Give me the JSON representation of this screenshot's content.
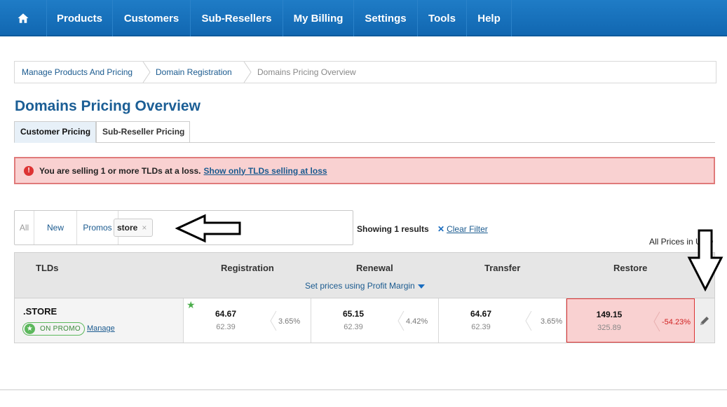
{
  "nav": {
    "items": [
      {
        "label": "Products"
      },
      {
        "label": "Customers"
      },
      {
        "label": "Sub-Resellers"
      },
      {
        "label": "My Billing"
      },
      {
        "label": "Settings"
      },
      {
        "label": "Tools"
      },
      {
        "label": "Help"
      }
    ]
  },
  "breadcrumb": {
    "items": [
      "Manage Products And Pricing",
      "Domain Registration",
      "Domains Pricing Overview"
    ]
  },
  "page": {
    "title": "Domains Pricing Overview"
  },
  "tabs": {
    "customer": "Customer Pricing",
    "subreseller": "Sub-Reseller Pricing"
  },
  "alert": {
    "text": "You are selling 1 or more TLDs at a loss.",
    "link": "Show only TLDs selling at loss"
  },
  "filters": {
    "all": "All",
    "new": "New",
    "promos": "Promos",
    "chip": "store",
    "chip_close": "×"
  },
  "results": {
    "showing": "Showing 1 results",
    "clear_filter": "Clear Filter",
    "all_prices": "All Prices in USD"
  },
  "table": {
    "headers": {
      "tlds": "TLDs",
      "registration": "Registration",
      "renewal": "Renewal",
      "transfer": "Transfer",
      "restore": "Restore"
    },
    "profit_margin_link": "Set prices using Profit Margin",
    "rows": [
      {
        "tld": ".STORE",
        "promo_badge": "ON PROMO",
        "manage": "Manage",
        "registration": {
          "price": "64.67",
          "cost": "62.39",
          "margin": "3.65%"
        },
        "renewal": {
          "price": "65.15",
          "cost": "62.39",
          "margin": "4.42%"
        },
        "transfer": {
          "price": "64.67",
          "cost": "62.39",
          "margin": "3.65%"
        },
        "restore": {
          "price": "149.15",
          "cost": "325.89",
          "margin": "-54.23%"
        }
      }
    ]
  },
  "colors": {
    "nav_bg": "#1f7cc6",
    "title": "#1b5e95",
    "alert_bg": "#f9d1d1",
    "alert_border": "#e07a7a",
    "loss_text": "#d02020",
    "promo_green": "#5cb85c"
  }
}
